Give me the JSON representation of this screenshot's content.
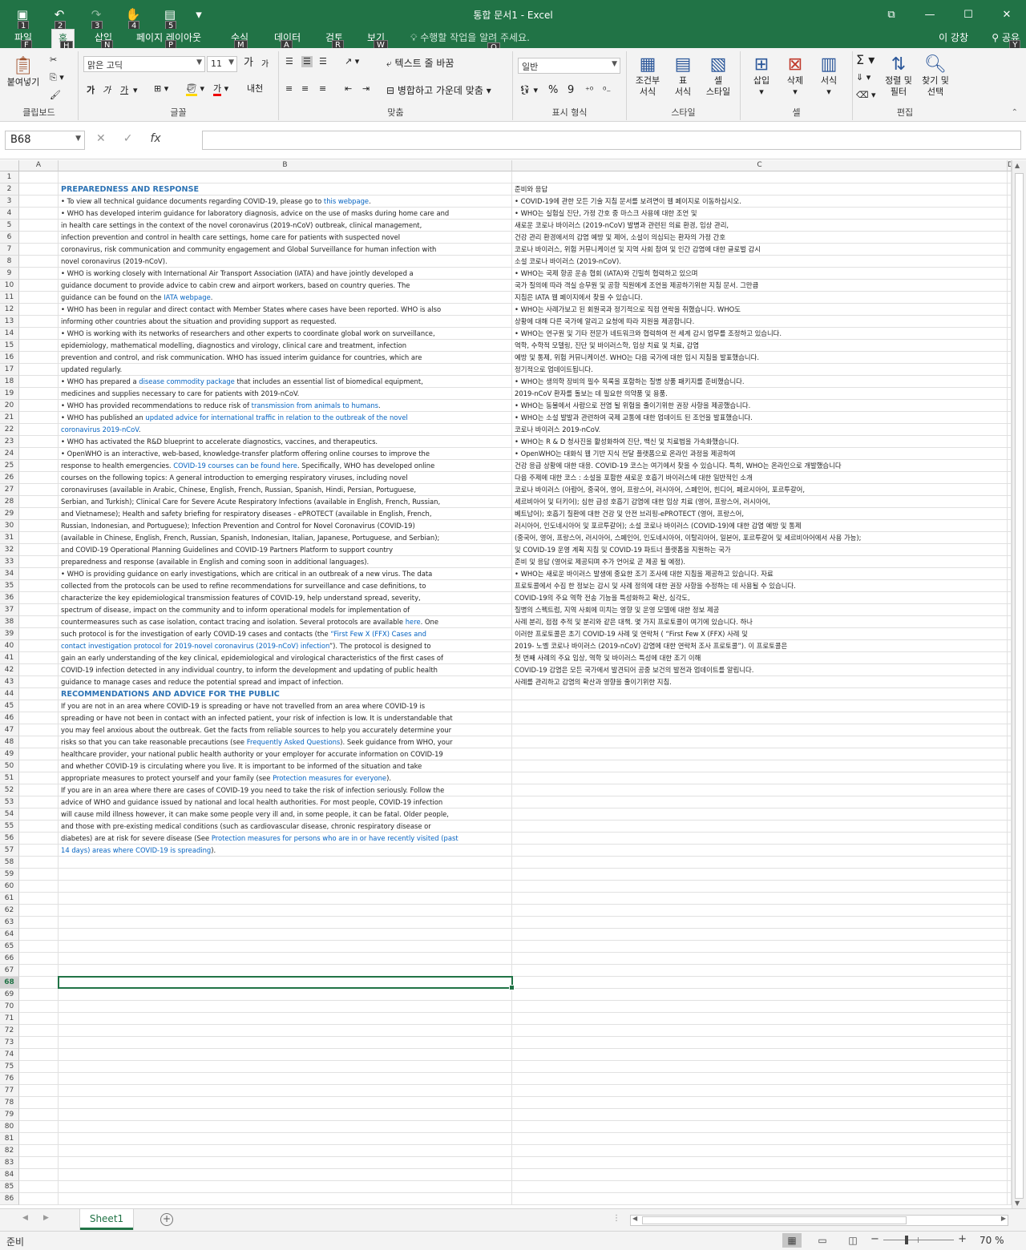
{
  "window": {
    "title": "통합 문서1 - Excel",
    "qat_keytips": [
      "1",
      "2",
      "3",
      "4",
      "5"
    ],
    "controls": {
      "ribbon_display": "⧉",
      "minimize": "—",
      "maximize": "☐",
      "close": "✕"
    }
  },
  "tabs": [
    {
      "label": "파일",
      "key": "F"
    },
    {
      "label": "홈",
      "key": "H",
      "active": true
    },
    {
      "label": "삽입",
      "key": "N"
    },
    {
      "label": "페이지 레이아웃",
      "key": "P"
    },
    {
      "label": "수식",
      "key": "M"
    },
    {
      "label": "데이터",
      "key": "A"
    },
    {
      "label": "검토",
      "key": "R"
    },
    {
      "label": "보기",
      "key": "W"
    }
  ],
  "tellme": {
    "placeholder": "수행할 작업을 알려 주세요.",
    "key": "Q"
  },
  "account": {
    "name": "이 강창",
    "share": "공유",
    "share_key": "Y"
  },
  "ribbon": {
    "clipboard": {
      "paste": "붙여넣기",
      "label": "클립보드"
    },
    "font": {
      "name": "맑은 고딕",
      "size": "11",
      "grow": "가",
      "shrink": "가",
      "bold": "가",
      "italic": "가",
      "underline": "가",
      "font_color": "가",
      "phonetic": "내천",
      "label": "글꼴"
    },
    "alignment": {
      "wrap": "텍스트 줄 바꿈",
      "merge": "병합하고 가운데 맞춤",
      "label": "맞춤"
    },
    "number": {
      "format": "일반",
      "percent": "%",
      "comma": "9",
      "label": "표시 형식"
    },
    "styles": {
      "conditional": "조건부\n서식",
      "table": "표\n서식",
      "cell_style": "셀\n스타일",
      "label": "스타일"
    },
    "cells": {
      "insert": "삽입",
      "delete": "삭제",
      "format": "서식",
      "label": "셀"
    },
    "editing": {
      "sort": "정렬 및\n필터",
      "find": "찾기 및\n선택",
      "label": "편집"
    }
  },
  "formula_bar": {
    "name_box": "B68",
    "value": ""
  },
  "columns": [
    "A",
    "B",
    "C",
    "D"
  ],
  "selected_row": 68,
  "total_rows": 86,
  "rows": [
    {
      "n": 1,
      "b": "",
      "c": ""
    },
    {
      "n": 2,
      "b": "PREPAREDNESS AND RESPONSE",
      "b_style": "hdr",
      "c": "준비와 응답"
    },
    {
      "n": 3,
      "b_parts": [
        {
          "t": "• To view all technical guidance documents regarding COVID-19, please go to "
        },
        {
          "t": "this webpage",
          "link": true
        },
        {
          "t": "."
        }
      ],
      "c": "• COVID-19에 관한 모든 기술 지침 문서를 보려면이 웹 페이지로 이동하십시오."
    },
    {
      "n": 4,
      "b": "• WHO has developed interim guidance for laboratory diagnosis, advice on the use of masks during home care and",
      "c": "• WHO는 실험실 진단, 가정 간호 중 마스크 사용에 대한 조언 및"
    },
    {
      "n": 5,
      "b": "in health care settings in the context of the novel coronavirus (2019-nCoV) outbreak, clinical management,",
      "c": "새로운 코로나 바이러스 (2019-nCoV) 발병과 관련된 의료 환경, 임상 관리,"
    },
    {
      "n": 6,
      "b": "infection prevention and control in health care settings, home care for patients with suspected novel",
      "c": "건강 관리 환경에서의 감염 예방 및 제어, 소설이 의심되는 환자의 가정 간호"
    },
    {
      "n": 7,
      "b": "coronavirus, risk communication and community engagement and Global Surveillance for human infection with",
      "c": "코로나 바이러스, 위험 커뮤니케이션 및 지역 사회 참여 및 인간 감염에 대한 글로벌 감시"
    },
    {
      "n": 8,
      "b": "novel coronavirus (2019-nCoV).",
      "c": "소설 코로나 바이러스 (2019-nCoV)."
    },
    {
      "n": 9,
      "b": "• WHO is working closely with International Air Transport Association (IATA) and have jointly developed a",
      "c": "• WHO는 국제 항공 운송 협회 (IATA)와 긴밀히 협력하고 있으며"
    },
    {
      "n": 10,
      "b": "guidance document to provide advice to cabin crew and airport workers, based on country queries. The",
      "c": "국가 질의에 따라 객실 승무원 및 공항 직원에게 조언을 제공하기위한 지침 문서. 그만큼"
    },
    {
      "n": 11,
      "b_parts": [
        {
          "t": "guidance can be found on the "
        },
        {
          "t": "IATA webpage",
          "link": true
        },
        {
          "t": "."
        }
      ],
      "c": "지침은 IATA 웹 페이지에서 찾을 수 있습니다."
    },
    {
      "n": 12,
      "b": "• WHO has been in regular and direct contact with Member States where cases have been reported. WHO is also",
      "c": "• WHO는 사례가보고 된 회원국과 정기적으로 직접 연락을 취했습니다. WHO도"
    },
    {
      "n": 13,
      "b": "informing other countries about the situation and providing support as requested.",
      "c": "상황에 대해 다른 국가에 알리고 요청에 따라 지원을 제공합니다."
    },
    {
      "n": 14,
      "b": "• WHO is working with its networks of researchers and other experts to coordinate global work on surveillance,",
      "c": "• WHO는 연구원 및 기타 전문가 네트워크와 협력하여 전 세계 감시 업무를 조정하고 있습니다."
    },
    {
      "n": 15,
      "b": "epidemiology, mathematical modelling, diagnostics and virology, clinical care and treatment, infection",
      "c": "역학, 수학적 모델링, 진단 및 바이러스학, 임상 치료 및 치료, 감염"
    },
    {
      "n": 16,
      "b": "prevention and control, and risk communication. WHO has issued interim guidance for countries, which are",
      "c": "예방 및 통제, 위험 커뮤니케이션. WHO는 다음 국가에 대한 임시 지침을 발표했습니다."
    },
    {
      "n": 17,
      "b": "updated regularly.",
      "c": "정기적으로 업데이트됩니다."
    },
    {
      "n": 18,
      "b_parts": [
        {
          "t": "• WHO has prepared a "
        },
        {
          "t": "disease commodity package",
          "link": true
        },
        {
          "t": " that includes an essential list of biomedical equipment,"
        }
      ],
      "c": "• WHO는 생의학 장비의 필수 목록을 포함하는 질병 상품 패키지를 준비했습니다."
    },
    {
      "n": 19,
      "b": "medicines and supplies necessary to care for patients with 2019-nCoV.",
      "c": "2019-nCoV 환자를 돌보는 데 필요한 의약품 및 용품."
    },
    {
      "n": 20,
      "b_parts": [
        {
          "t": "• WHO has provided recommendations to reduce risk of "
        },
        {
          "t": "transmission from animals to humans",
          "link": true
        },
        {
          "t": "."
        }
      ],
      "c": "• WHO는 동물에서 사람으로 전염 될 위험을 줄이기위한 권장 사항을 제공했습니다."
    },
    {
      "n": 21,
      "b_parts": [
        {
          "t": "• WHO has published an "
        },
        {
          "t": "updated advice for international traffic in relation to the outbreak of the novel",
          "link": true
        }
      ],
      "c": "• WHO는 소설 발발과 관련하여 국제 교통에 대한 업데이트 된 조언을 발표했습니다."
    },
    {
      "n": 22,
      "b_parts": [
        {
          "t": "coronavirus 2019-nCoV",
          "link": true
        },
        {
          "t": "."
        }
      ],
      "c": "코로나 바이러스 2019-nCoV."
    },
    {
      "n": 23,
      "b": "• WHO has activated the R&D blueprint to accelerate diagnostics, vaccines, and therapeutics.",
      "c": "• WHO는 R & D 청사진을 활성화하여 진단, 백신 및 치료법을 가속화했습니다."
    },
    {
      "n": 24,
      "b": "• OpenWHO is an interactive, web-based, knowledge-transfer platform offering online courses to improve the",
      "c": "• OpenWHO는 대화식 웹 기반 지식 전달 플랫폼으로 온라인 과정을 제공하여"
    },
    {
      "n": 25,
      "b_parts": [
        {
          "t": "response to health emergencies. "
        },
        {
          "t": "COVID-19 courses can be found here",
          "link": true
        },
        {
          "t": ". Specifically, WHO has developed online"
        }
      ],
      "c": "건강 응급 상황에 대한 대응. COVID-19 코스는 여기에서 찾을 수 있습니다. 특히, WHO는 온라인으로 개발했습니다"
    },
    {
      "n": 26,
      "b": "courses on the following topics: A general introduction to emerging respiratory viruses, including novel",
      "c": "다음 주제에 대한 코스 : 소설을 포함한 새로운 호흡기 바이러스에 대한 일반적인 소개"
    },
    {
      "n": 27,
      "b": "coronaviruses (available in Arabic, Chinese, English, French, Russian, Spanish, Hindi, Persian, Portuguese,",
      "c": "코로나 바이러스 (아랍어, 중국어, 영어, 프랑스어, 러시아어, 스페인어, 힌디어, 페르시아어, 포르투갈어,"
    },
    {
      "n": 28,
      "b": "Serbian, and Turkish); Clinical Care for Severe Acute Respiratory Infections (available in English, French, Russian,",
      "c": "세르비아어 및 터키어); 심한 급성 호흡기 감염에 대한 임상 치료 (영어, 프랑스어, 러시아어,"
    },
    {
      "n": 29,
      "b": "and Vietnamese); Health and safety briefing for respiratory diseases - ePROTECT (available in English, French,",
      "c": "베트남어); 호흡기 질환에 대한 건강 및 안전 브리핑-ePROTECT (영어, 프랑스어,"
    },
    {
      "n": 30,
      "b": "Russian, Indonesian, and Portuguese); Infection Prevention and Control for Novel Coronavirus (COVID-19)",
      "c": "러시아어, 인도네시아어 및 포르투갈어); 소설 코로나 바이러스 (COVID-19)에 대한 감염 예방 및 통제"
    },
    {
      "n": 31,
      "b": "(available in Chinese, English, French, Russian, Spanish, Indonesian, Italian, Japanese, Portuguese, and Serbian);",
      "c": "(중국어, 영어, 프랑스어, 러시아어, 스페인어, 인도네시아어, 이탈리아어, 일본어, 포르투갈어 및 세르비아어에서 사용 가능);"
    },
    {
      "n": 32,
      "b": "and COVID-19 Operational Planning Guidelines and COVID-19 Partners Platform to support country",
      "c": "및 COVID-19 운영 계획 지침 및 COVID-19 파트너 플랫폼을 지원하는 국가"
    },
    {
      "n": 33,
      "b": "preparedness and response (available in English and coming soon in additional languages).",
      "c": "준비 및 응답 (영어로 제공되며 추가 언어로 곧 제공 될 예정)."
    },
    {
      "n": 34,
      "b": "• WHO is providing guidance on early investigations, which are critical in an outbreak of a new virus. The data",
      "c": "• WHO는 새로운 바이러스 발생에 중요한 조기 조사에 대한 지침을 제공하고 있습니다. 자료"
    },
    {
      "n": 35,
      "b": "collected from the protocols can be used to refine recommendations for surveillance and case definitions, to",
      "c": "프로토콜에서 수집 한 정보는 감시 및 사례 정의에 대한 권장 사항을 수정하는 데 사용될 수 있습니다."
    },
    {
      "n": 36,
      "b": "characterize the key epidemiological transmission features of COVID-19, help understand spread, severity,",
      "c": "COVID-19의 주요 역학 전송 기능을 특성화하고 확산, 심각도,"
    },
    {
      "n": 37,
      "b": "spectrum of disease, impact on the community and to inform operational models for implementation of",
      "c": "질병의 스펙트럼, 지역 사회에 미치는 영향 및 운영 모델에 대한 정보 제공"
    },
    {
      "n": 38,
      "b_parts": [
        {
          "t": "countermeasures such as case isolation, contact tracing and isolation. Several protocols are available "
        },
        {
          "t": "here",
          "link": true
        },
        {
          "t": ". One"
        }
      ],
      "c": "사례 분리, 접점 추적 및 분리와 같은 대책. 몇 가지 프로토콜이 여기에 있습니다. 하나"
    },
    {
      "n": 39,
      "b_parts": [
        {
          "t": "such protocol is for the investigation of early COVID-19 cases and contacts (the "
        },
        {
          "t": "“First Few X (FFX) Cases and",
          "link": true
        }
      ],
      "c": "이러한 프로토콜은 초기 COVID-19 사례 및 연락처 ( “First Few X (FFX) 사례 및"
    },
    {
      "n": 40,
      "b_parts": [
        {
          "t": "contact investigation protocol for 2019-novel coronavirus (2019-nCoV) infection",
          "link": true
        },
        {
          "t": "”). The protocol is designed to"
        }
      ],
      "c": "2019- 노벨 코로나 바이러스 (2019-nCoV) 감염에 대한 연락처 조사 프로토콜”). 이 프로토콜은"
    },
    {
      "n": 41,
      "b": "gain an early understanding of the key clinical, epidemiological and virological characteristics of the first cases of",
      "c": "첫 번째 사례의 주요 임상, 역학 및 바이러스 특성에 대한 조기 이해"
    },
    {
      "n": 42,
      "b": "COVID-19 infection detected in any individual country, to inform the development and updating of public health",
      "c": "COVID-19 감염은 모든 국가에서 발견되어 공중 보건의 발전과 업데이트를 알립니다."
    },
    {
      "n": 43,
      "b": "guidance to manage cases and reduce the potential spread and impact of infection.",
      "c": "사례를 관리하고 감염의 확산과 영향을 줄이기위한 지침."
    },
    {
      "n": 44,
      "b": "RECOMMENDATIONS AND ADVICE FOR THE PUBLIC",
      "b_style": "hdr",
      "c": ""
    },
    {
      "n": 45,
      "b": "If you are not in an area where COVID-19 is spreading or have not travelled from an area where COVID-19 is",
      "c": ""
    },
    {
      "n": 46,
      "b": "spreading or have not been in contact with an infected patient, your risk of infection is low. It is understandable that",
      "c": ""
    },
    {
      "n": 47,
      "b": "you may feel anxious about the outbreak. Get the facts from reliable sources to help you accurately determine your",
      "c": ""
    },
    {
      "n": 48,
      "b_parts": [
        {
          "t": "risks so that you can take reasonable precautions (see "
        },
        {
          "t": "Frequently Asked Questions",
          "link": true
        },
        {
          "t": "). Seek guidance from WHO, your"
        }
      ],
      "c": ""
    },
    {
      "n": 49,
      "b": "healthcare provider, your national public health authority or your employer for accurate information on COVID-19",
      "c": ""
    },
    {
      "n": 50,
      "b": "and whether COVID-19 is circulating where you live. It is important to be informed of the situation and take",
      "c": ""
    },
    {
      "n": 51,
      "b_parts": [
        {
          "t": "appropriate measures to protect yourself and your family (see "
        },
        {
          "t": "Protection measures for everyone",
          "link": true
        },
        {
          "t": ")."
        }
      ],
      "c": ""
    },
    {
      "n": 52,
      "b": "If you are in an area where there are cases of COVID-19 you need to take the risk of infection seriously. Follow the",
      "c": ""
    },
    {
      "n": 53,
      "b": "advice of WHO and guidance issued by national and local health authorities. For most people, COVID-19 infection",
      "c": ""
    },
    {
      "n": 54,
      "b": "will cause mild illness however, it can make some people very ill and, in some people, it can be fatal. Older people,",
      "c": ""
    },
    {
      "n": 55,
      "b": "and those with pre-existing medical conditions (such as cardiovascular disease, chronic respiratory disease or",
      "c": ""
    },
    {
      "n": 56,
      "b_parts": [
        {
          "t": "diabetes) are at risk for severe disease (See "
        },
        {
          "t": "Protection measures for persons who are in or have recently visited (past",
          "link": true
        }
      ],
      "c": ""
    },
    {
      "n": 57,
      "b_parts": [
        {
          "t": "14 days) areas where COVID-19 is spreading",
          "link": true
        },
        {
          "t": ")."
        }
      ],
      "c": ""
    }
  ],
  "sheets": [
    {
      "name": "Sheet1",
      "active": true
    }
  ],
  "status": {
    "ready": "준비",
    "zoom_level": 70,
    "zoom_label": "70 %"
  }
}
